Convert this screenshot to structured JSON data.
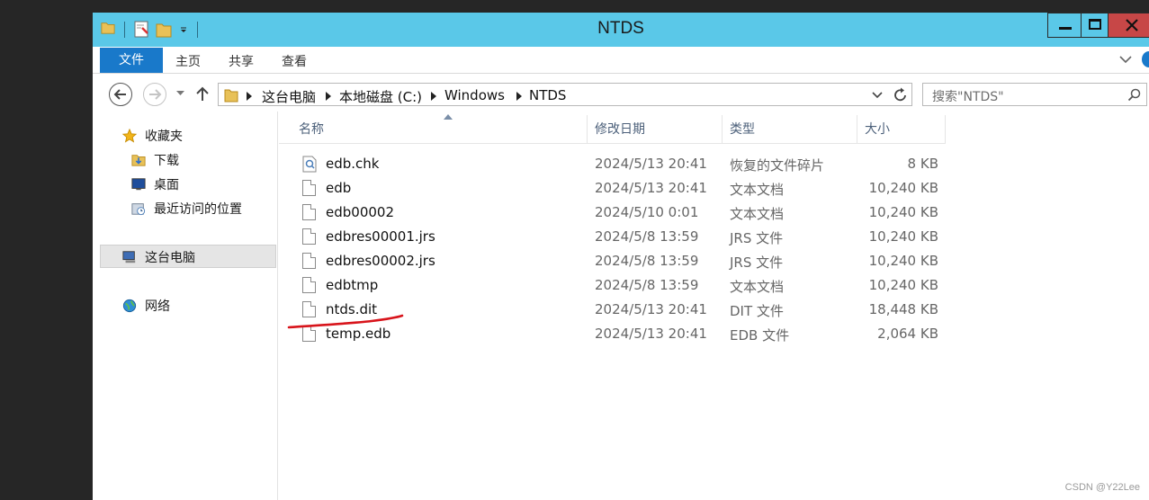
{
  "window": {
    "title": "NTDS"
  },
  "ribbon": {
    "tabs": [
      "文件",
      "主页",
      "共享",
      "查看"
    ]
  },
  "address": {
    "crumbs": [
      "这台电脑",
      "本地磁盘 (C:)",
      "Windows",
      "NTDS"
    ],
    "search_placeholder": "搜索\"NTDS\""
  },
  "nav": {
    "favorites": "收藏夹",
    "downloads": "下载",
    "desktop": "桌面",
    "recent": "最近访问的位置",
    "this_pc": "这台电脑",
    "network": "网络"
  },
  "columns": {
    "name": "名称",
    "date": "修改日期",
    "type": "类型",
    "size": "大小"
  },
  "files": [
    {
      "name": "edb.chk",
      "date": "2024/5/13 20:41",
      "type": "恢复的文件碎片",
      "size": "8 KB"
    },
    {
      "name": "edb",
      "date": "2024/5/13 20:41",
      "type": "文本文档",
      "size": "10,240 KB"
    },
    {
      "name": "edb00002",
      "date": "2024/5/10 0:01",
      "type": "文本文档",
      "size": "10,240 KB"
    },
    {
      "name": "edbres00001.jrs",
      "date": "2024/5/8 13:59",
      "type": "JRS 文件",
      "size": "10,240 KB"
    },
    {
      "name": "edbres00002.jrs",
      "date": "2024/5/8 13:59",
      "type": "JRS 文件",
      "size": "10,240 KB"
    },
    {
      "name": "edbtmp",
      "date": "2024/5/8 13:59",
      "type": "文本文档",
      "size": "10,240 KB"
    },
    {
      "name": "ntds.dit",
      "date": "2024/5/13 20:41",
      "type": "DIT 文件",
      "size": "18,448 KB"
    },
    {
      "name": "temp.edb",
      "date": "2024/5/13 20:41",
      "type": "EDB 文件",
      "size": "2,064 KB"
    }
  ],
  "watermark": "CSDN @Y22Lee",
  "colors": {
    "titlebar": "#5ac8e8",
    "file_tab": "#1979ca",
    "close": "#c74747",
    "annotation": "#d8141b"
  }
}
